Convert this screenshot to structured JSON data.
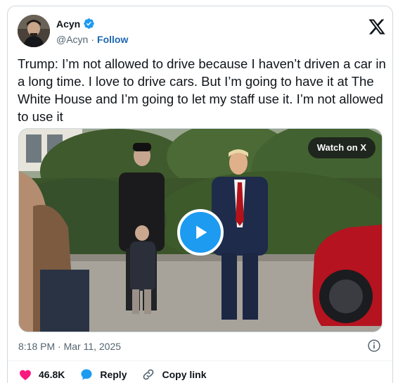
{
  "author": {
    "display_name": "Acyn",
    "handle": "@Acyn",
    "separator": "·",
    "follow_label": "Follow"
  },
  "tweet": {
    "text": "Trump: I’m not allowed to drive because I haven’t driven a car in a long time. I love to drive cars. But I’m going to have it at The White House and I’m going to let my staff use it. I’m not allowed to use it"
  },
  "media": {
    "watch_label": "Watch on X"
  },
  "meta": {
    "timestamp": "8:18 PM · Mar 11, 2025"
  },
  "actions": {
    "like_count": "46.8K",
    "reply_label": "Reply",
    "copy_link_label": "Copy link"
  },
  "colors": {
    "accent": "#1d9bf0",
    "like": "#f91880",
    "follow": "#1d68b3",
    "muted": "#536471",
    "border": "#cfd9de"
  },
  "icons": [
    "verified-badge-icon",
    "x-logo-icon",
    "play-icon",
    "info-icon",
    "heart-icon",
    "reply-bubble-icon",
    "link-icon"
  ]
}
